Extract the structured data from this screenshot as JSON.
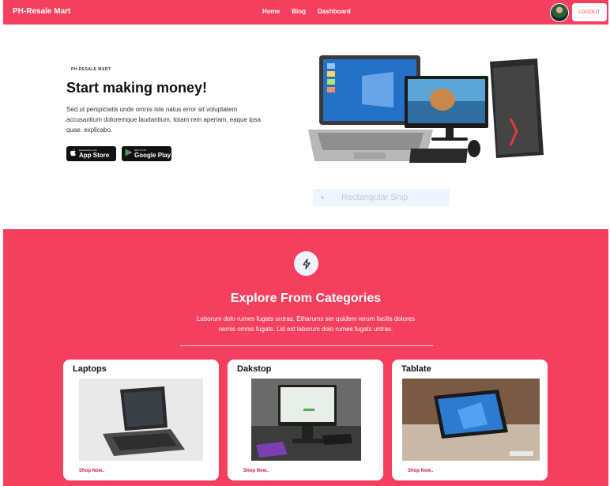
{
  "nav": {
    "brand": "PH-Resale Mart",
    "links": [
      "Home",
      "Blog",
      "Dashboard"
    ],
    "logout": "LOGOUT"
  },
  "hero": {
    "eyebrow": "PH-RESALE MART",
    "title": "Start making money!",
    "text": "Sed ut perspiciatis unde omnis iste natus error sit voluptatem accusantium doloremque laudantium, totam rem aperiam, eaque ipsa quae. explicabo.",
    "appstore": {
      "sub": "Download on the",
      "main": "App Store"
    },
    "gplay": {
      "sub": "GET IT ON",
      "main": "Google Play"
    }
  },
  "snip": {
    "label": "Rectangular Snip"
  },
  "categories": {
    "title": "Explore From Categories",
    "text": "Laborum dolo rumes fugats untras. Etharums ser quidem rerum facilis dolores nemis omnis fugats. Lid est laborum dolo rumes fugats untras.",
    "cards": [
      {
        "name": "Laptops",
        "shop": "Shop Now.."
      },
      {
        "name": "Dakstop",
        "shop": "Shop Now.."
      },
      {
        "name": "Tablate",
        "shop": "Shop Now.."
      }
    ]
  },
  "icons": [
    "apple-icon",
    "play-icon",
    "bolt-icon"
  ],
  "colors": {
    "brand": "#f43f5e",
    "shop_link": "#c81e3c"
  }
}
